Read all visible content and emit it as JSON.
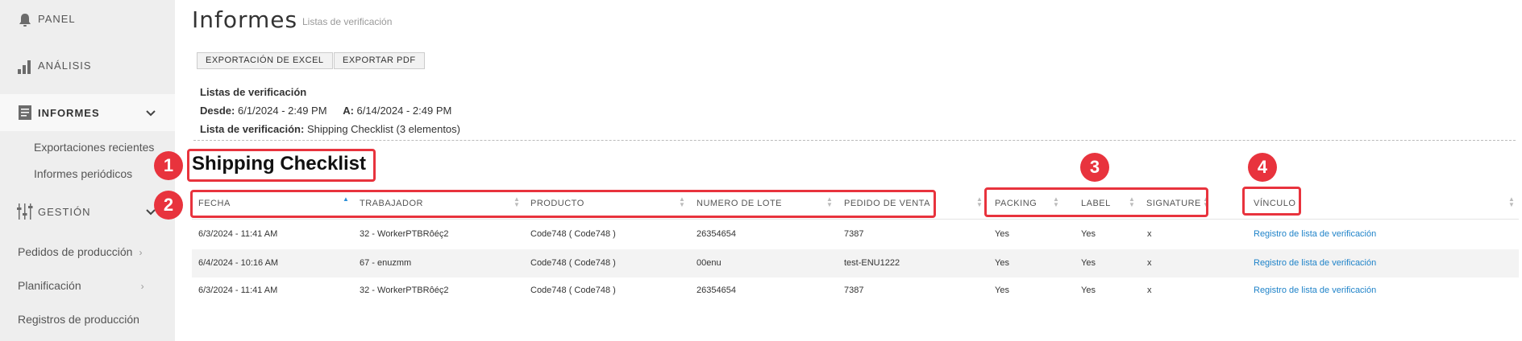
{
  "sidebar": {
    "items": [
      {
        "label": "PANEL",
        "icon": "bell-icon"
      },
      {
        "label": "ANÁLISIS",
        "icon": "bar-chart-icon"
      },
      {
        "label": "INFORMES",
        "icon": "report-icon"
      },
      {
        "label": "GESTIÓN",
        "icon": "sliders-icon"
      }
    ],
    "informes_sub": [
      "Exportaciones recientes",
      "Informes periódicos"
    ],
    "gestion_sub": [
      "Pedidos de producción",
      "Planificación",
      "Registros de producción"
    ]
  },
  "header": {
    "title": "Informes",
    "subtitle": "Listas de verificación"
  },
  "toolbar": {
    "excel_label": "EXPORTACIÓN DE EXCEL",
    "pdf_label": "EXPORTAR PDF"
  },
  "meta": {
    "heading": "Listas de verificación",
    "from_label": "Desde:",
    "from_value": "6/1/2024 - 2:49 PM",
    "to_label": "A:",
    "to_value": "6/14/2024 - 2:49 PM",
    "checklist_label": "Lista de verificación:",
    "checklist_value": "Shipping Checklist (3 elementos)"
  },
  "checklist_title": "Shipping Checklist",
  "table": {
    "columns": [
      "FECHA",
      "TRABAJADOR",
      "PRODUCTO",
      "NUMERO DE LOTE",
      "PEDIDO DE VENTA",
      "PACKING",
      "LABEL",
      "SIGNATURE",
      "VÍNCULO"
    ],
    "rows": [
      [
        "6/3/2024 - 11:41 AM",
        "32 - WorkerPTBRôéç2",
        "Code748 ( Code748 )",
        "26354654",
        "7387",
        "Yes",
        "Yes",
        "x",
        "Registro de lista de verificación"
      ],
      [
        "6/4/2024 - 10:16 AM",
        "67 - enuzmm",
        "Code748 ( Code748 )",
        "00enu",
        "test-ENU1222",
        "Yes",
        "Yes",
        "x",
        "Registro de lista de verificación"
      ],
      [
        "6/3/2024 - 11:41 AM",
        "32 - WorkerPTBRôéç2",
        "Code748 ( Code748 )",
        "26354654",
        "7387",
        "Yes",
        "Yes",
        "x",
        "Registro de lista de verificación"
      ]
    ]
  },
  "annotations": [
    "1",
    "2",
    "3",
    "4"
  ],
  "colors": {
    "annotation": "#e8333d",
    "link": "#1f83c9",
    "sort_active": "#2a8fd8",
    "sidebar_bg": "#eeeeee"
  }
}
